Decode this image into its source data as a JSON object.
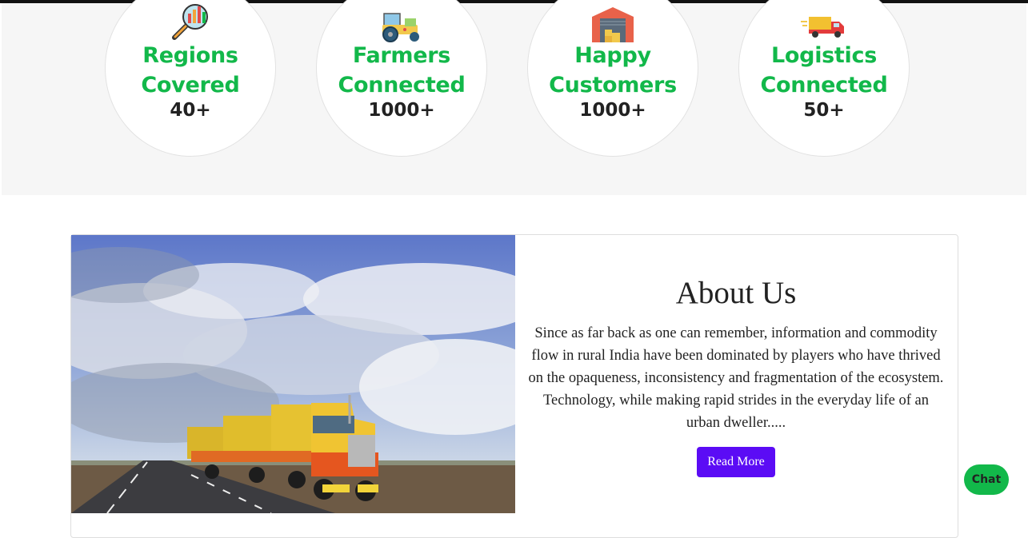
{
  "stats": [
    {
      "title_line1": "Regions",
      "title_line2": "Covered",
      "value": "40+",
      "icon": "magnifier-chart-icon"
    },
    {
      "title_line1": "Farmers",
      "title_line2": "Connected",
      "value": "1000+",
      "icon": "tractor-icon"
    },
    {
      "title_line1": "Happy",
      "title_line2": "Customers",
      "value": "1000+",
      "icon": "warehouse-icon"
    },
    {
      "title_line1": "Logistics",
      "title_line2": "Connected",
      "value": "50+",
      "icon": "delivery-truck-icon"
    }
  ],
  "about": {
    "title": "About Us",
    "body": "Since as far back as one can remember, information and commodity flow in rural India have been dominated by players who have thrived on the opaqueness, inconsistency and fragmentation of the ecosystem. Technology, while making rapid strides in the everyday life of an urban dweller.....",
    "button_label": "Read More"
  },
  "chat": {
    "label": "Chat"
  },
  "colors": {
    "accent_green": "#12b84a",
    "button_purple": "#5b0cf5"
  }
}
